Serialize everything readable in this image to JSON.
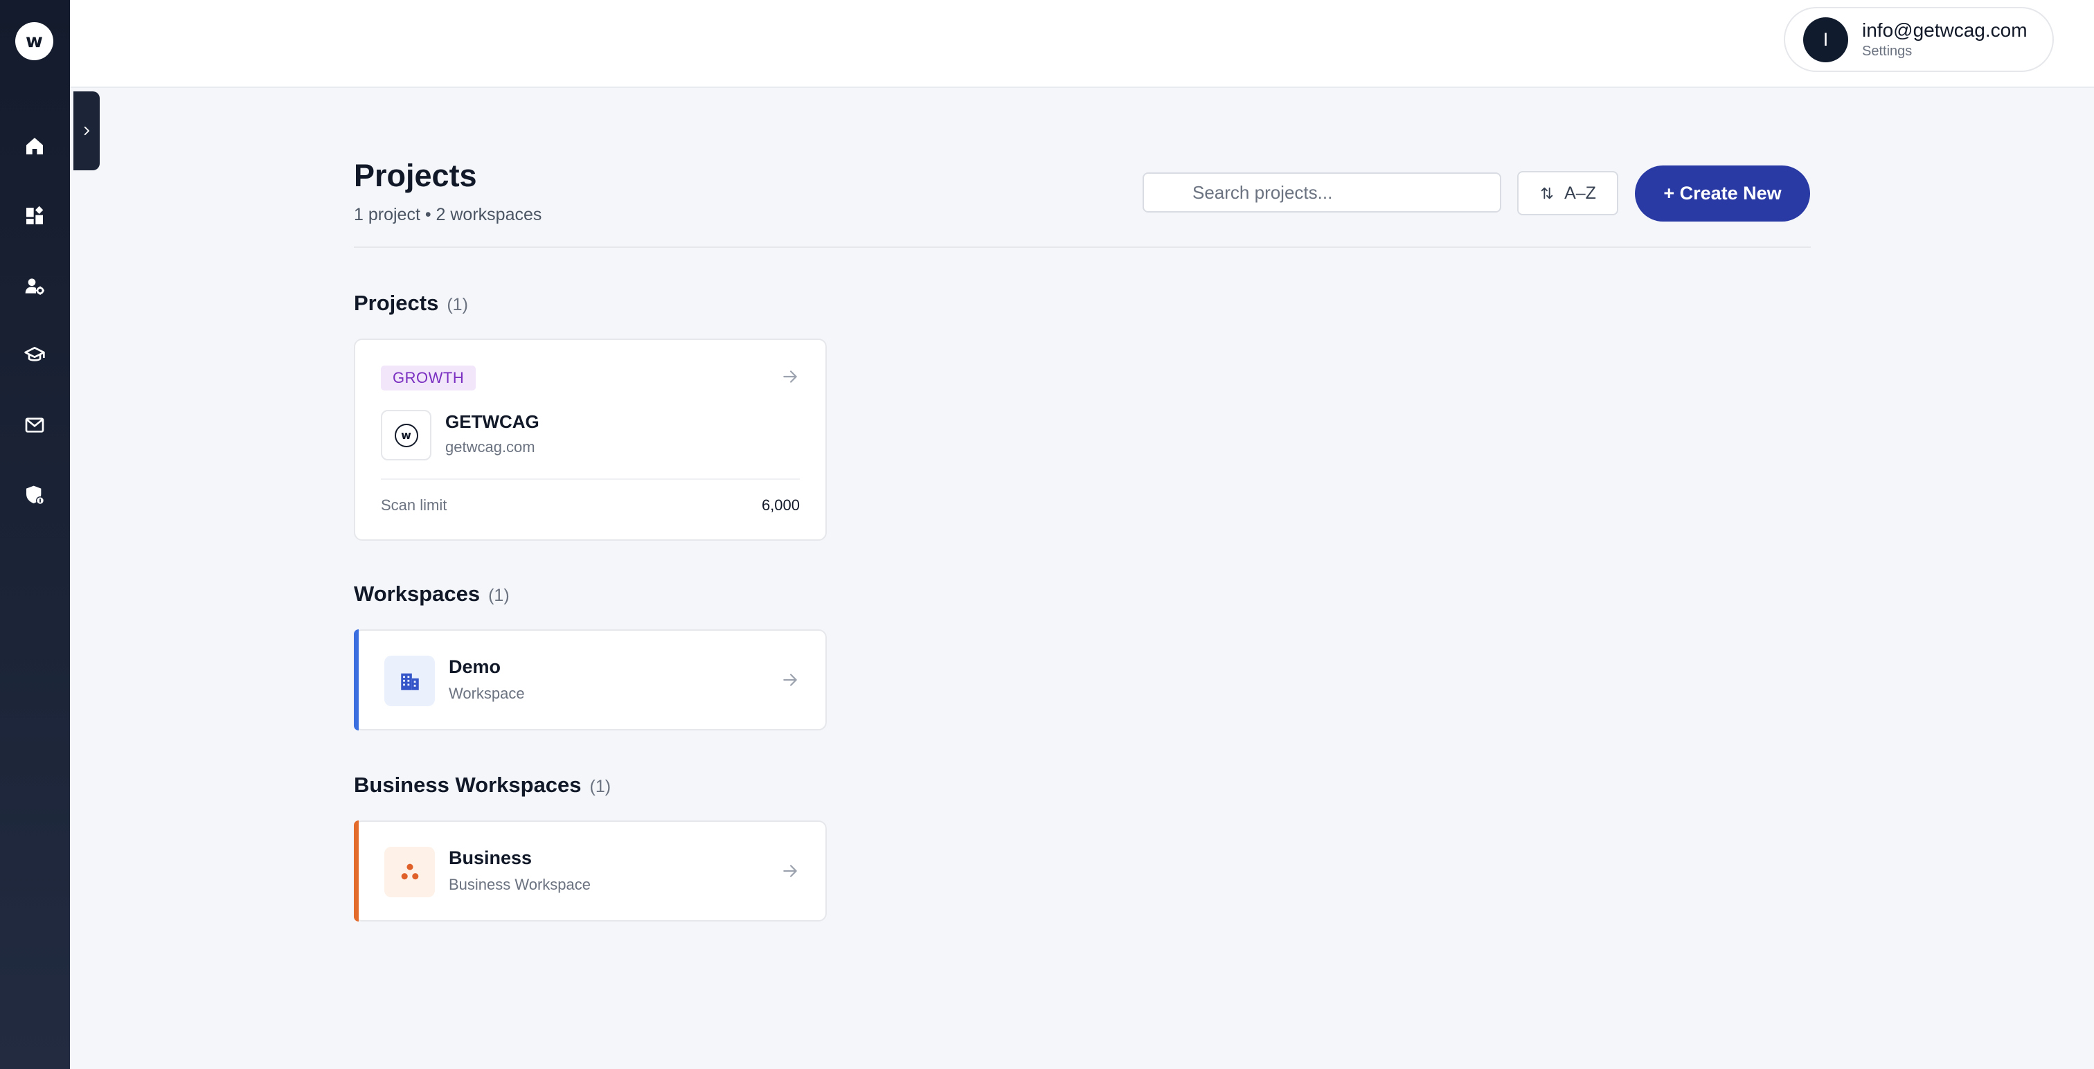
{
  "sidebar": {
    "logo_letter": "w",
    "items": [
      {
        "name": "home-icon"
      },
      {
        "name": "dashboard-icon"
      },
      {
        "name": "user-settings-icon"
      },
      {
        "name": "graduation-cap-icon"
      },
      {
        "name": "mail-icon"
      },
      {
        "name": "shield-icon"
      }
    ]
  },
  "header": {
    "user": {
      "avatar_initial": "I",
      "email": "info@getwcag.com",
      "subtitle": "Settings"
    }
  },
  "main": {
    "title": "Projects",
    "subtitle": "1 project • 2 workspaces",
    "search_placeholder": "Search projects...",
    "sort_label": "A–Z",
    "create_label": "+ Create New"
  },
  "sections": {
    "projects": {
      "title": "Projects",
      "count": "(1)",
      "items": [
        {
          "badge": "GROWTH",
          "logo_letter": "w",
          "name": "GETWCAG",
          "domain": "getwcag.com",
          "scan_label": "Scan limit",
          "scan_value": "6,000"
        }
      ]
    },
    "workspaces": {
      "title": "Workspaces",
      "count": "(1)",
      "items": [
        {
          "name": "Demo",
          "type": "Workspace",
          "accent": "#3b6fe0",
          "icon": "building-icon"
        }
      ]
    },
    "business_workspaces": {
      "title": "Business Workspaces",
      "count": "(1)",
      "items": [
        {
          "name": "Business",
          "type": "Business Workspace",
          "accent": "#e36b2c",
          "icon": "dots-cluster-icon"
        }
      ]
    }
  },
  "colors": {
    "sidebar_bg": "#1c2538",
    "primary": "#2a3aa5",
    "growth_badge_bg": "#f2e6fb",
    "growth_badge_text": "#7a2fc0",
    "workspace_accent": "#3b6fe0",
    "business_accent": "#e36b2c"
  }
}
